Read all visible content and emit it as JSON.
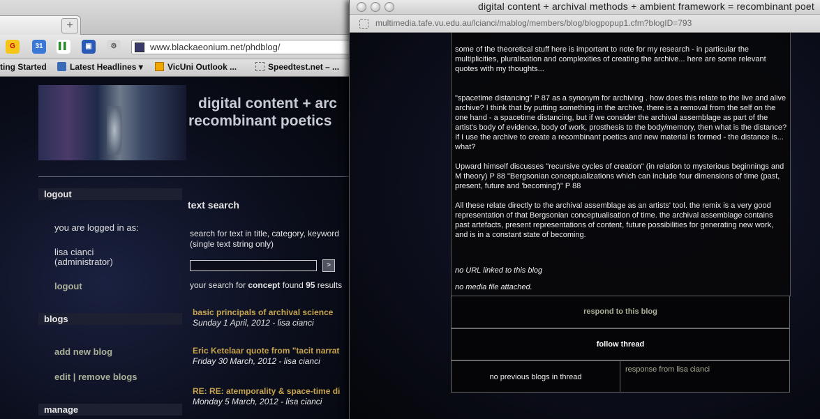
{
  "back_window": {
    "url": "www.blackaeonium.net/phdblog/",
    "new_tab_label": "+",
    "extensions": [
      {
        "name": "google-icon",
        "glyph": "G",
        "bg": "#f5c518",
        "fg": "#c00"
      },
      {
        "name": "calendar-icon",
        "glyph": "31",
        "bg": "#3a78d8",
        "fg": "#fff"
      },
      {
        "name": "docs-icon",
        "glyph": "▌▌",
        "bg": "#fff",
        "fg": "#2a8a2a"
      },
      {
        "name": "share-icon",
        "glyph": "▣",
        "bg": "#2a5ab8",
        "fg": "#fff"
      },
      {
        "name": "gear-icon",
        "glyph": "⚙",
        "bg": "#d8d8d8",
        "fg": "#555"
      }
    ],
    "bookmarks": [
      {
        "label": "ting Started"
      },
      {
        "label": "Latest Headlines ▾"
      },
      {
        "label": "VicUni Outlook ..."
      },
      {
        "label": "Speedtest.net – ..."
      }
    ],
    "site_title": [
      "digital content + arc",
      "recombinant poetics"
    ],
    "sidebar": {
      "logout_header": "logout",
      "logged_in_as": "you are logged in as:",
      "user_name": "lisa cianci",
      "user_role": "(administrator)",
      "logout_link": "logout",
      "blogs_header": "blogs",
      "add_new_blog": "add new blog",
      "edit_remove_blogs": "edit | remove blogs",
      "manage_header": "manage"
    },
    "search": {
      "heading": "text search",
      "desc1": "search for text in title, category, keyword",
      "desc2": "(single text string only)",
      "go_label": ">",
      "result_prefix": "your search for ",
      "term": "concept",
      "found_text": " found ",
      "count": "95",
      "result_suffix": " results"
    },
    "results": [
      {
        "title": "basic principals of archival science",
        "date": "Sunday 1 April, 2012 - lisa cianci"
      },
      {
        "title": "Eric Ketelaar quote from \"tacit narrat",
        "date": "Friday 30 March, 2012 - lisa cianci"
      },
      {
        "title": "RE: RE: atemporality & space-time di",
        "date": "Monday 5 March, 2012 - lisa cianci"
      }
    ]
  },
  "front_window": {
    "title": "digital content + archival methods + ambient framework = recombinant poet",
    "url": "multimedia.tafe.vu.edu.au/lcianci/mablog/members/blog/blogpopup1.cfm?blogID=793",
    "paragraphs": [
      "some of the theoretical stuff here is important to note for my research - in particular the multiplicities, pluralisation and complexities of creating the archive... here are some relevant quotes with my thoughts...",
      "\"spacetime distancing\" P 87 as a synonym for archiving . how does this relate to the live and alive archive? I think that by putting something in the archive, there is a removal from the self on the one hand - a spacetime distancing, but if we consider the archival assemblage as part of the artist's body of evidence, body of work, prosthesis to the body/memory, then what is the distance? If I use the archive to create a recombinant poetics and new material is formed - the distance is... what?",
      "Upward himself discusses \"recursive cycles of creation\" (in relation to mysterious beginnings and M theory) P 88 \"Bergsonian conceptualizations which can include four dimensions of time (past, present, future and 'becoming')\" P 88",
      "All these relate directly to the archival assemblage as an artists' tool. the remix is a very good representation of that Bergsonian conceptualisation of time. the archival assemblage contains past artefacts, present representations of content, future possibilities for generating new work, and is in a constant state of becoming."
    ],
    "no_url": "no URL linked to this blog",
    "no_media": "no media file attached.",
    "respond": "respond to this blog",
    "follow_thread": "follow thread",
    "no_previous": "no previous blogs in thread",
    "response_from": "response from lisa cianci"
  }
}
